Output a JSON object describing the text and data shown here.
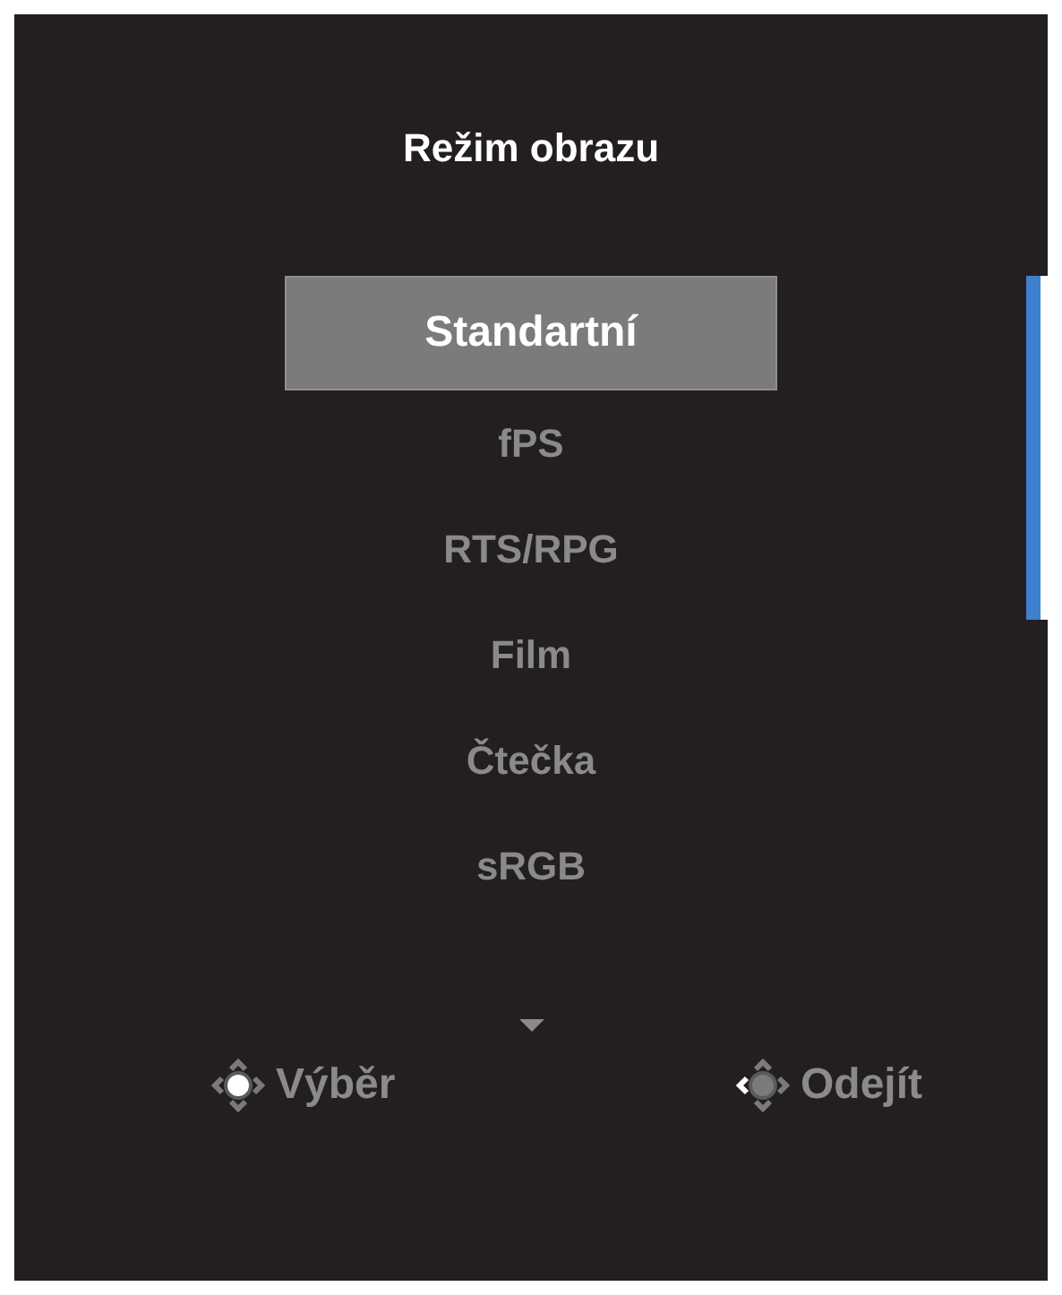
{
  "title": "Režim obrazu",
  "items": [
    {
      "label": "Standartní",
      "selected": true
    },
    {
      "label": "fPS",
      "selected": false
    },
    {
      "label": "RTS/RPG",
      "selected": false
    },
    {
      "label": "Film",
      "selected": false
    },
    {
      "label": "Čtečka",
      "selected": false
    },
    {
      "label": "sRGB",
      "selected": false
    }
  ],
  "hints": [
    {
      "kind": "select",
      "label": "Výběr"
    },
    {
      "kind": "exit",
      "label": "Odejít"
    }
  ]
}
